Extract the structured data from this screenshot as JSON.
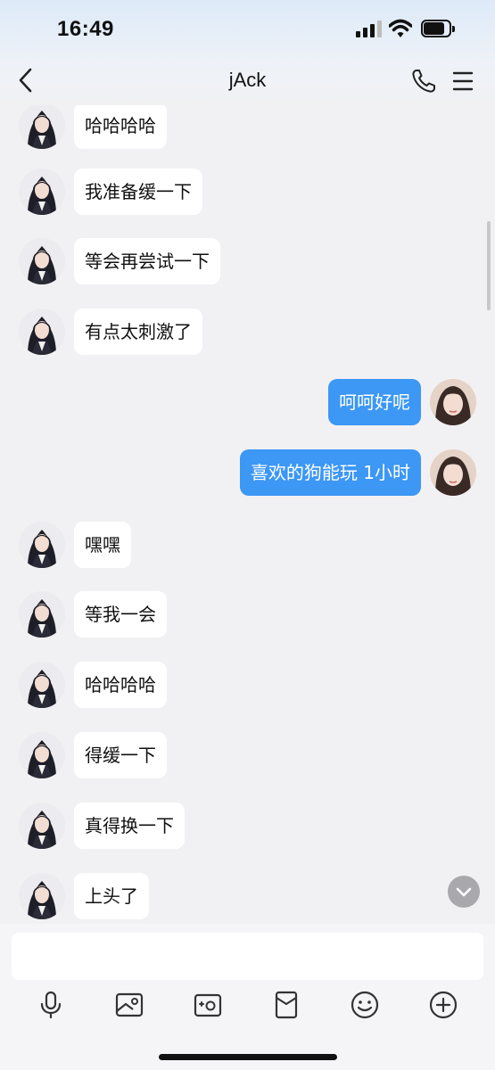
{
  "status_bar": {
    "time": "16:49"
  },
  "header": {
    "title": "jAck"
  },
  "messages": [
    {
      "side": "left",
      "text": "哈哈哈哈"
    },
    {
      "side": "left",
      "text": "我准备缓一下"
    },
    {
      "side": "left",
      "text": "等会再尝试一下"
    },
    {
      "side": "left",
      "text": "有点太刺激了"
    },
    {
      "side": "right",
      "text": "呵呵好呢"
    },
    {
      "side": "right",
      "text": "喜欢的狗能玩 1小时"
    },
    {
      "side": "left",
      "text": "嘿嘿"
    },
    {
      "side": "left",
      "text": "等我一会"
    },
    {
      "side": "left",
      "text": "哈哈哈哈"
    },
    {
      "side": "left",
      "text": "得缓一下"
    },
    {
      "side": "left",
      "text": "真得换一下"
    },
    {
      "side": "left",
      "text": "上头了"
    }
  ],
  "input": {
    "value": "",
    "placeholder": ""
  },
  "toolbar": {
    "icons": [
      "microphone-icon",
      "image-icon",
      "camera-icon",
      "red-packet-icon",
      "emoji-icon",
      "plus-icon"
    ]
  },
  "colors": {
    "accent": "#3c97f5",
    "background": "#f1f1f3",
    "bubble_left": "#ffffff"
  }
}
